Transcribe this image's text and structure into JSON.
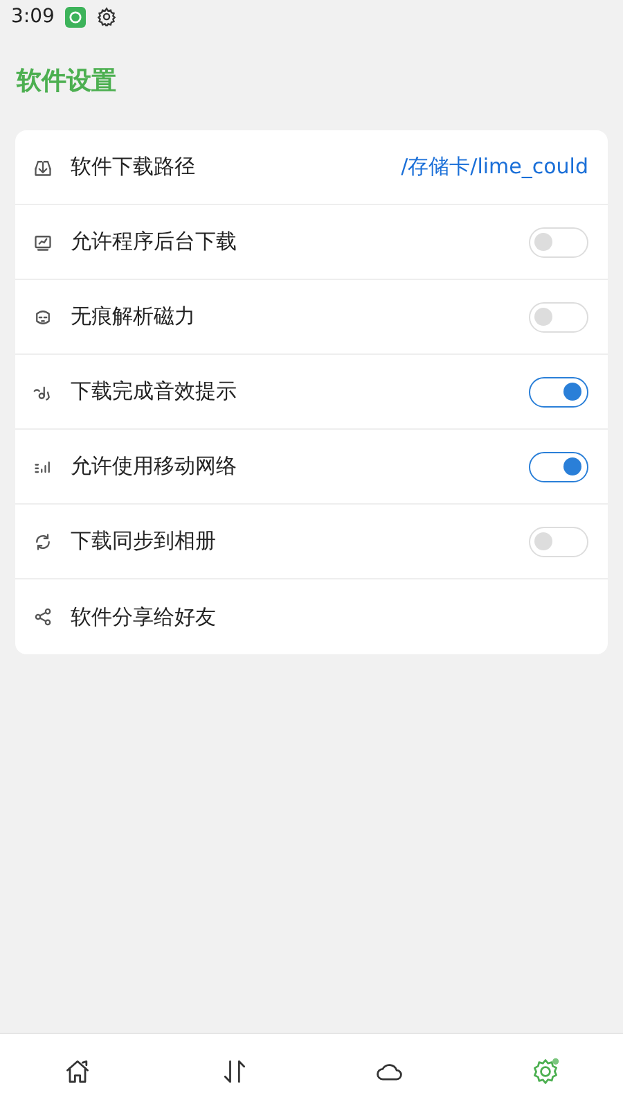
{
  "status_bar": {
    "time": "3:09"
  },
  "title": "软件设置",
  "settings": [
    {
      "kind": "link",
      "label": "软件下载路径",
      "value": "/存储卡/lime_could"
    },
    {
      "kind": "toggle",
      "label": "允许程序后台下载",
      "on": false
    },
    {
      "kind": "toggle",
      "label": "无痕解析磁力",
      "on": false
    },
    {
      "kind": "toggle",
      "label": "下载完成音效提示",
      "on": true
    },
    {
      "kind": "toggle",
      "label": "允许使用移动网络",
      "on": true
    },
    {
      "kind": "toggle",
      "label": "下载同步到相册",
      "on": false
    },
    {
      "kind": "plain",
      "label": "软件分享给好友"
    }
  ],
  "bottom_nav": [
    {
      "selected": false
    },
    {
      "selected": false
    },
    {
      "selected": false
    },
    {
      "selected": true
    }
  ]
}
